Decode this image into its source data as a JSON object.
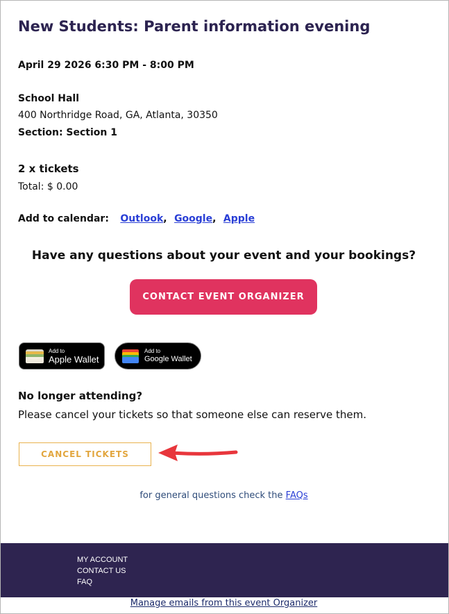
{
  "event": {
    "title": "New Students: Parent information evening",
    "datetime": "April 29 2026 6:30 PM - 8:00 PM",
    "venue": "School Hall",
    "address": "400 Northridge Road, GA, Atlanta, 30350",
    "section": "Section: Section 1"
  },
  "order": {
    "tickets": "2 x tickets",
    "total": "Total: $ 0.00"
  },
  "calendar": {
    "label": "Add to calendar:",
    "links": [
      "Outlook",
      "Google",
      "Apple"
    ],
    "separator": ","
  },
  "questions": {
    "text": "Have any questions about your event and your bookings?",
    "button_label": "CONTACT EVENT ORGANIZER"
  },
  "wallets": {
    "apple": {
      "small": "Add to",
      "big": "Apple Wallet",
      "icon": "apple-wallet-icon"
    },
    "google": {
      "small": "Add to",
      "big": "Google Wallet",
      "icon": "google-wallet-icon"
    }
  },
  "cancel": {
    "heading": "No longer attending?",
    "text": "Please cancel your tickets so that someone else can reserve them.",
    "button_label": "CANCEL TICKETS"
  },
  "faq": {
    "prefix": "for general questions check the",
    "link": "FAQs"
  },
  "footer": {
    "links": [
      "MY ACCOUNT",
      "CONTACT US",
      "FAQ"
    ],
    "manage": "Manage emails from this event Organizer"
  },
  "colors": {
    "title": "#2c2350",
    "primary_button": "#e0335f",
    "cancel_accent": "#e9b24e",
    "link": "#2a3fd6",
    "footer_bg": "#2e2450",
    "arrow": "#e8363c"
  }
}
